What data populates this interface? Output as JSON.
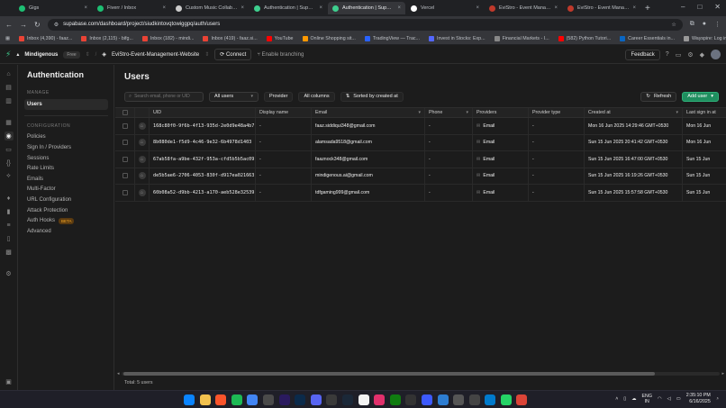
{
  "browser": {
    "tabs": [
      {
        "label": "Gigs",
        "color": "#1dbf73",
        "active": false
      },
      {
        "label": "Fiverr / Inbox",
        "color": "#1dbf73",
        "active": false
      },
      {
        "label": "Custom Music Collaborati",
        "color": "#cccccc",
        "active": false
      },
      {
        "label": "Authentication | Supabas",
        "color": "#3ecf8e",
        "active": false
      },
      {
        "label": "Authentication | Supabas",
        "color": "#3ecf8e",
        "active": true
      },
      {
        "label": "Vercel",
        "color": "#ffffff",
        "active": false
      },
      {
        "label": "EviStro - Event Managem",
        "color": "#c0392b",
        "active": false
      },
      {
        "label": "EviStro - Event Managem",
        "color": "#c0392b",
        "active": false
      }
    ],
    "new_tab": "+",
    "url": "supabase.com/dashboard/project/siudkintovqtowiggpq/auth/users",
    "bookmarks": [
      {
        "label": "Inbox (4,390) - faaz...",
        "color": "#ea4335"
      },
      {
        "label": "Inbox (2,115) - bifg...",
        "color": "#ea4335"
      },
      {
        "label": "Inbox (182) - mindi...",
        "color": "#ea4335"
      },
      {
        "label": "Inbox (419) - faaz.si...",
        "color": "#ea4335"
      },
      {
        "label": "YouTube",
        "color": "#ff0000"
      },
      {
        "label": "Online Shopping sit...",
        "color": "#ff9900"
      },
      {
        "label": "TradingView — Trac...",
        "color": "#2962ff"
      },
      {
        "label": "Invest in Stocks: Exp...",
        "color": "#5367ff"
      },
      {
        "label": "Financial Markets - I...",
        "color": "#888888"
      },
      {
        "label": "(582) Python Tutori...",
        "color": "#ff0000"
      },
      {
        "label": "Career Essentials in...",
        "color": "#0a66c2"
      },
      {
        "label": "Wayspire: Log in to...",
        "color": "#999999"
      }
    ],
    "all_bookmarks": "All Bookmarks"
  },
  "app": {
    "org_name": "Mindigenous",
    "plan": "Free",
    "project_name": "EviStro-Event-Management-Website",
    "connect_label": "Connect",
    "branching_label": "Enable branching",
    "feedback_label": "Feedback"
  },
  "sidebar": {
    "title": "Authentication",
    "manage_heading": "MANAGE",
    "manage_items": [
      {
        "label": "Users",
        "active": true
      }
    ],
    "config_heading": "CONFIGURATION",
    "config_items": [
      {
        "label": "Policies"
      },
      {
        "label": "Sign In / Providers"
      },
      {
        "label": "Sessions"
      },
      {
        "label": "Rate Limits"
      },
      {
        "label": "Emails"
      },
      {
        "label": "Multi-Factor"
      },
      {
        "label": "URL Configuration"
      },
      {
        "label": "Attack Protection"
      },
      {
        "label": "Auth Hooks",
        "badge": "BETA"
      },
      {
        "label": "Advanced"
      }
    ]
  },
  "main": {
    "title": "Users",
    "search_placeholder": "Search email, phone or UID",
    "filter_value": "All users",
    "provider_label": "Provider",
    "columns_label": "All columns",
    "sort_label": "Sorted by created at",
    "refresh_label": "Refresh",
    "add_user_label": "Add user",
    "columns": [
      "UID",
      "Display name",
      "Email",
      "Phone",
      "Providers",
      "Provider type",
      "Created at",
      "Last sign in at"
    ],
    "rows": [
      {
        "uid": "168c80f0-9f6b-4f13-935d-2e0d9e48a4b7",
        "display": "-",
        "email": "faaz.siddiqui348@gmail.com",
        "phone": "-",
        "provider": "Email",
        "ptype": "-",
        "created": "Mon 16 Jun 2025 14:29:46 GMT+0530",
        "last": "Mon 16 Jun"
      },
      {
        "uid": "8b080de1-f5d9-4c46-9e32-6b4978d1403",
        "display": "-",
        "email": "alamsada9518@gmail.com",
        "phone": "-",
        "provider": "Email",
        "ptype": "-",
        "created": "Sun 15 Jun 2025 20:41:42 GMT+0530",
        "last": "Mon 16 Jun"
      },
      {
        "uid": "67ab58fa-a9be-432f-953a-cfd5b5b5ac09",
        "display": "-",
        "email": "faaznock348@gmail.com",
        "phone": "-",
        "provider": "Email",
        "ptype": "-",
        "created": "Sun 15 Jun 2025 16:47:00 GMT+0530",
        "last": "Sun 15 Jun"
      },
      {
        "uid": "de5b5ae6-2706-4053-830f-d917ea021663",
        "display": "-",
        "email": "mindigenous.ai@gmail.com",
        "phone": "-",
        "provider": "Email",
        "ptype": "-",
        "created": "Sun 15 Jun 2025 16:19:26 GMT+0530",
        "last": "Sun 15 Jun"
      },
      {
        "uid": "60b08a52-d9bb-4213-a170-aeb528e32539",
        "display": "-",
        "email": "tdfgaming999@gmail.com",
        "phone": "-",
        "provider": "Email",
        "ptype": "-",
        "created": "Sun 15 Jun 2025 15:57:58 GMT+0530",
        "last": "Sun 15 Jun"
      }
    ],
    "footer": "Total: 5 users"
  },
  "taskbar": {
    "apps": [
      {
        "icon": "windows-icon",
        "color": "#0a84ff"
      },
      {
        "icon": "file-explorer-icon",
        "color": "#f2c14e"
      },
      {
        "icon": "brave-icon",
        "color": "#fb542b"
      },
      {
        "icon": "spotify-icon",
        "color": "#1db954"
      },
      {
        "icon": "chrome-icon",
        "color": "#4285f4"
      },
      {
        "icon": "chatgpt-icon",
        "color": "#4a4a4a"
      },
      {
        "icon": "premiere-icon",
        "color": "#2a1a5e"
      },
      {
        "icon": "photoshop-icon",
        "color": "#0b2a4a"
      },
      {
        "icon": "discord-icon",
        "color": "#5865f2"
      },
      {
        "icon": "app-icon",
        "color": "#3a3a3a"
      },
      {
        "icon": "steam-icon",
        "color": "#1b2838"
      },
      {
        "icon": "store-icon",
        "color": "#f3f3f3"
      },
      {
        "icon": "instagram-icon",
        "color": "#e1306c"
      },
      {
        "icon": "xbox-icon",
        "color": "#107c10"
      },
      {
        "icon": "terminal-icon",
        "color": "#333333"
      },
      {
        "icon": "vpn-icon",
        "color": "#3d5afe"
      },
      {
        "icon": "app2-icon",
        "color": "#2d7dd2"
      },
      {
        "icon": "obs-icon",
        "color": "#555555"
      },
      {
        "icon": "notepad-icon",
        "color": "#444444"
      },
      {
        "icon": "vscode-icon",
        "color": "#007acc"
      },
      {
        "icon": "whatsapp-icon",
        "color": "#25d366"
      },
      {
        "icon": "chrome2-icon",
        "color": "#db4437"
      }
    ],
    "lang_top": "ENG",
    "lang_bottom": "IN",
    "time": "2:35:10 PM",
    "date": "6/16/2025"
  }
}
